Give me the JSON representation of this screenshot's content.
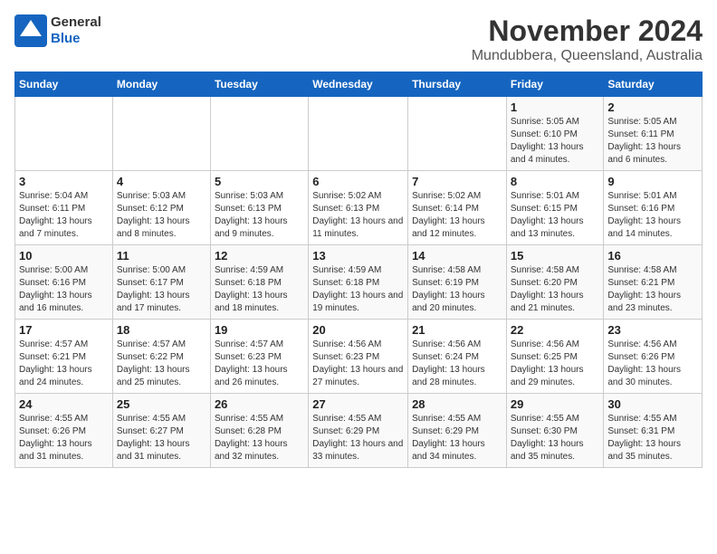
{
  "header": {
    "logo_general": "General",
    "logo_blue": "Blue",
    "month": "November 2024",
    "location": "Mundubbera, Queensland, Australia"
  },
  "days_of_week": [
    "Sunday",
    "Monday",
    "Tuesday",
    "Wednesday",
    "Thursday",
    "Friday",
    "Saturday"
  ],
  "weeks": [
    [
      {
        "day": "",
        "info": ""
      },
      {
        "day": "",
        "info": ""
      },
      {
        "day": "",
        "info": ""
      },
      {
        "day": "",
        "info": ""
      },
      {
        "day": "",
        "info": ""
      },
      {
        "day": "1",
        "info": "Sunrise: 5:05 AM\nSunset: 6:10 PM\nDaylight: 13 hours and 4 minutes."
      },
      {
        "day": "2",
        "info": "Sunrise: 5:05 AM\nSunset: 6:11 PM\nDaylight: 13 hours and 6 minutes."
      }
    ],
    [
      {
        "day": "3",
        "info": "Sunrise: 5:04 AM\nSunset: 6:11 PM\nDaylight: 13 hours and 7 minutes."
      },
      {
        "day": "4",
        "info": "Sunrise: 5:03 AM\nSunset: 6:12 PM\nDaylight: 13 hours and 8 minutes."
      },
      {
        "day": "5",
        "info": "Sunrise: 5:03 AM\nSunset: 6:13 PM\nDaylight: 13 hours and 9 minutes."
      },
      {
        "day": "6",
        "info": "Sunrise: 5:02 AM\nSunset: 6:13 PM\nDaylight: 13 hours and 11 minutes."
      },
      {
        "day": "7",
        "info": "Sunrise: 5:02 AM\nSunset: 6:14 PM\nDaylight: 13 hours and 12 minutes."
      },
      {
        "day": "8",
        "info": "Sunrise: 5:01 AM\nSunset: 6:15 PM\nDaylight: 13 hours and 13 minutes."
      },
      {
        "day": "9",
        "info": "Sunrise: 5:01 AM\nSunset: 6:16 PM\nDaylight: 13 hours and 14 minutes."
      }
    ],
    [
      {
        "day": "10",
        "info": "Sunrise: 5:00 AM\nSunset: 6:16 PM\nDaylight: 13 hours and 16 minutes."
      },
      {
        "day": "11",
        "info": "Sunrise: 5:00 AM\nSunset: 6:17 PM\nDaylight: 13 hours and 17 minutes."
      },
      {
        "day": "12",
        "info": "Sunrise: 4:59 AM\nSunset: 6:18 PM\nDaylight: 13 hours and 18 minutes."
      },
      {
        "day": "13",
        "info": "Sunrise: 4:59 AM\nSunset: 6:18 PM\nDaylight: 13 hours and 19 minutes."
      },
      {
        "day": "14",
        "info": "Sunrise: 4:58 AM\nSunset: 6:19 PM\nDaylight: 13 hours and 20 minutes."
      },
      {
        "day": "15",
        "info": "Sunrise: 4:58 AM\nSunset: 6:20 PM\nDaylight: 13 hours and 21 minutes."
      },
      {
        "day": "16",
        "info": "Sunrise: 4:58 AM\nSunset: 6:21 PM\nDaylight: 13 hours and 23 minutes."
      }
    ],
    [
      {
        "day": "17",
        "info": "Sunrise: 4:57 AM\nSunset: 6:21 PM\nDaylight: 13 hours and 24 minutes."
      },
      {
        "day": "18",
        "info": "Sunrise: 4:57 AM\nSunset: 6:22 PM\nDaylight: 13 hours and 25 minutes."
      },
      {
        "day": "19",
        "info": "Sunrise: 4:57 AM\nSunset: 6:23 PM\nDaylight: 13 hours and 26 minutes."
      },
      {
        "day": "20",
        "info": "Sunrise: 4:56 AM\nSunset: 6:23 PM\nDaylight: 13 hours and 27 minutes."
      },
      {
        "day": "21",
        "info": "Sunrise: 4:56 AM\nSunset: 6:24 PM\nDaylight: 13 hours and 28 minutes."
      },
      {
        "day": "22",
        "info": "Sunrise: 4:56 AM\nSunset: 6:25 PM\nDaylight: 13 hours and 29 minutes."
      },
      {
        "day": "23",
        "info": "Sunrise: 4:56 AM\nSunset: 6:26 PM\nDaylight: 13 hours and 30 minutes."
      }
    ],
    [
      {
        "day": "24",
        "info": "Sunrise: 4:55 AM\nSunset: 6:26 PM\nDaylight: 13 hours and 31 minutes."
      },
      {
        "day": "25",
        "info": "Sunrise: 4:55 AM\nSunset: 6:27 PM\nDaylight: 13 hours and 31 minutes."
      },
      {
        "day": "26",
        "info": "Sunrise: 4:55 AM\nSunset: 6:28 PM\nDaylight: 13 hours and 32 minutes."
      },
      {
        "day": "27",
        "info": "Sunrise: 4:55 AM\nSunset: 6:29 PM\nDaylight: 13 hours and 33 minutes."
      },
      {
        "day": "28",
        "info": "Sunrise: 4:55 AM\nSunset: 6:29 PM\nDaylight: 13 hours and 34 minutes."
      },
      {
        "day": "29",
        "info": "Sunrise: 4:55 AM\nSunset: 6:30 PM\nDaylight: 13 hours and 35 minutes."
      },
      {
        "day": "30",
        "info": "Sunrise: 4:55 AM\nSunset: 6:31 PM\nDaylight: 13 hours and 35 minutes."
      }
    ]
  ]
}
